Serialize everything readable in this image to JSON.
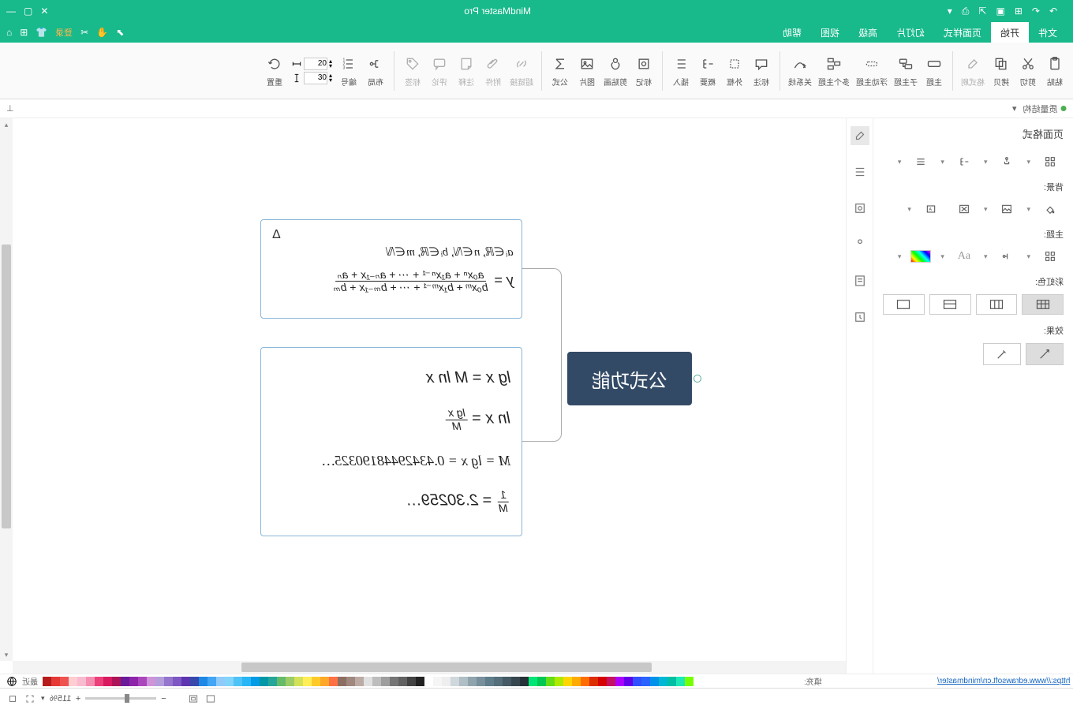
{
  "app_title": "MindMaster Pro",
  "titlebar_icons": [
    "logo",
    "undo",
    "redo",
    "new",
    "tabs",
    "export",
    "print",
    "more"
  ],
  "window_controls": [
    "min",
    "max",
    "close"
  ],
  "menu": {
    "tabs": [
      "文件",
      "开始",
      "页面样式",
      "幻灯片",
      "高级",
      "视图",
      "帮助"
    ],
    "active": "开始",
    "login": "登录"
  },
  "ribbon": {
    "items": [
      {
        "id": "paste",
        "label": "粘贴"
      },
      {
        "id": "cut",
        "label": "剪切"
      },
      {
        "id": "copy",
        "label": "拷贝"
      },
      {
        "id": "format",
        "label": "格式刷"
      },
      {
        "id": "sep"
      },
      {
        "id": "theme",
        "label": "主题"
      },
      {
        "id": "subtopic",
        "label": "子主题"
      },
      {
        "id": "floattopic",
        "label": "浮动主题"
      },
      {
        "id": "multitopic",
        "label": "多个主题"
      },
      {
        "id": "relation",
        "label": "关系线"
      },
      {
        "id": "sep"
      },
      {
        "id": "callout",
        "label": "标注"
      },
      {
        "id": "boundary",
        "label": "外框"
      },
      {
        "id": "summary",
        "label": "概要"
      },
      {
        "id": "number",
        "label": "插入"
      },
      {
        "id": "sep"
      },
      {
        "id": "mark",
        "label": "标记"
      },
      {
        "id": "clipart",
        "label": "剪贴画"
      },
      {
        "id": "image",
        "label": "图片"
      },
      {
        "id": "formula",
        "label": "公式"
      },
      {
        "id": "sep"
      },
      {
        "id": "hyperlink",
        "label": "超链接"
      },
      {
        "id": "attach",
        "label": "附件"
      },
      {
        "id": "note",
        "label": "注释"
      },
      {
        "id": "comment",
        "label": "评论"
      },
      {
        "id": "tag",
        "label": "标签"
      },
      {
        "id": "sep"
      },
      {
        "id": "layout",
        "label": "布局"
      },
      {
        "id": "numbering",
        "label": "编号"
      },
      {
        "id": "spin",
        "a": "20",
        "b": "30"
      },
      {
        "id": "reset",
        "label": "重置"
      }
    ]
  },
  "subbar": {
    "left": "⌖",
    "right_label": "质量结构"
  },
  "right_panel": {
    "title": "页面格式",
    "section_bg": "背景:",
    "section_theme": "主题:",
    "section_rainbow": "彩虹色:",
    "section_effect": "效果:"
  },
  "canvas": {
    "root_label": "公式功能",
    "node1_line1": "aᵢ∈ℝ, n∈ℕ, bᵢ∈ℝ, m∈ℕ",
    "node1_delta": "Δ",
    "node1_frac_lhs": "y = ",
    "node1_frac_num": "a₀xⁿ + a₁xⁿ⁻¹ + ⋯ + aₙ₋₁x + aₙ",
    "node1_frac_den": "b₀xᵐ + b₁xᵐ⁻¹ + ⋯ + bₘ₋₁x + bₘ",
    "node2_l1_lhs": "lg x = ",
    "node2_l1_rhs": "M ln x",
    "node2_l2_lhs": "ln x = ",
    "node2_l2_num": "lg x",
    "node2_l2_den": "M",
    "node2_l3": "M = lg x = 0.43429448190325…",
    "node2_l4_num": "1",
    "node2_l4_den": "M",
    "node2_l4_rhs": " = 2.30259…"
  },
  "colorbar": {
    "label": "填充:",
    "link": "https://www.edrawsoft.cn/mindmaster/",
    "colors": [
      "#b71c1c",
      "#e53935",
      "#ef5350",
      "#ffcdd2",
      "#f8bbd0",
      "#f48fb1",
      "#ec407a",
      "#d81b60",
      "#ad1457",
      "#6a1b9a",
      "#8e24aa",
      "#ab47bc",
      "#ce93d8",
      "#b39ddb",
      "#9575cd",
      "#7e57c2",
      "#5e35b1",
      "#3949ab",
      "#1e88e5",
      "#42a5f5",
      "#90caf9",
      "#81d4fa",
      "#4fc3f7",
      "#29b6f6",
      "#039be5",
      "#0097a7",
      "#26a69a",
      "#66bb6a",
      "#9ccc65",
      "#d4e157",
      "#ffee58",
      "#ffca28",
      "#ffa726",
      "#ff7043",
      "#8d6e63",
      "#a1887f",
      "#bcaaa4",
      "#e0e0e0",
      "#bdbdbd",
      "#9e9e9e",
      "#757575",
      "#616161",
      "#424242",
      "#212121",
      "#ffffff",
      "#f5f5f5",
      "#eeeeee",
      "#cfd8dc",
      "#b0bec5",
      "#90a4ae",
      "#78909c",
      "#607d8b",
      "#546e7a",
      "#455a64",
      "#37474f",
      "#263238",
      "#00e676",
      "#00c853",
      "#64dd17",
      "#aeea00",
      "#ffd600",
      "#ffab00",
      "#ff6d00",
      "#dd2c00",
      "#d50000",
      "#c51162",
      "#aa00ff",
      "#6200ea",
      "#304ffe",
      "#2962ff",
      "#0091ea",
      "#00b8d4",
      "#00bfa5",
      "#1de9b6",
      "#76ff03"
    ]
  },
  "status": {
    "zoom": "115%",
    "fit": "⊡",
    "grid": "▦"
  }
}
